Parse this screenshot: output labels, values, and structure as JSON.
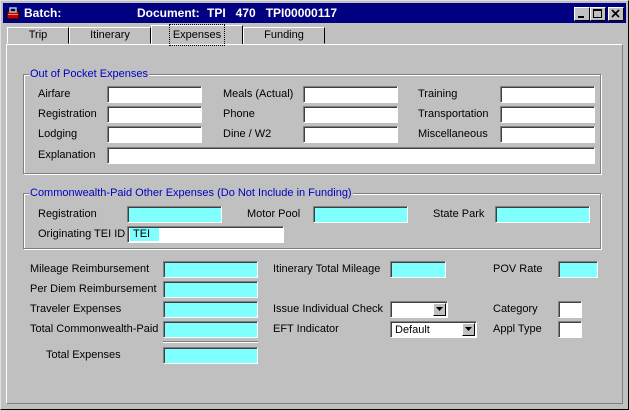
{
  "title": {
    "batch_label": "Batch:",
    "document_label": "Document:",
    "document_value": "TPI   470   TPI00000117"
  },
  "tabs": [
    {
      "label": "Trip"
    },
    {
      "label": "Itinerary"
    },
    {
      "label": "Expenses"
    },
    {
      "label": "Funding"
    }
  ],
  "active_tab": "Expenses",
  "out_of_pocket": {
    "legend": "Out of Pocket Expenses",
    "airfare": "Airfare",
    "registration": "Registration",
    "lodging": "Lodging",
    "meals": "Meals  (Actual)",
    "phone": "Phone",
    "dine_w2": "Dine / W2",
    "training": "Training",
    "transportation": "Transportation",
    "miscellaneous": "Miscellaneous",
    "explanation": "Explanation"
  },
  "commonwealth": {
    "legend": "Commonwealth-Paid Other Expenses (Do Not Include in Funding)",
    "registration": "Registration",
    "motor_pool": "Motor Pool",
    "state_park": "State Park",
    "originating_tei_id": "Originating TEI ID",
    "originating_tei_value": "TEI"
  },
  "summary": {
    "mileage_reimbursement": "Mileage Reimbursement",
    "per_diem_reimbursement": "Per Diem Reimbursement",
    "traveler_expenses": "Traveler Expenses",
    "total_commonwealth_paid": "Total Commonwealth-Paid",
    "total_expenses": "Total Expenses",
    "itinerary_total_mileage": "Itinerary Total Mileage",
    "issue_individual_check": "Issue Individual Check",
    "issue_individual_check_value": "",
    "eft_indicator": "EFT Indicator",
    "eft_indicator_value": "Default",
    "pov_rate": "POV Rate",
    "category": "Category",
    "appl_type": "Appl Type"
  },
  "colors": {
    "titlebar": "#000080",
    "computed_field": "#80ffff",
    "legend_text": "#0000c0"
  }
}
